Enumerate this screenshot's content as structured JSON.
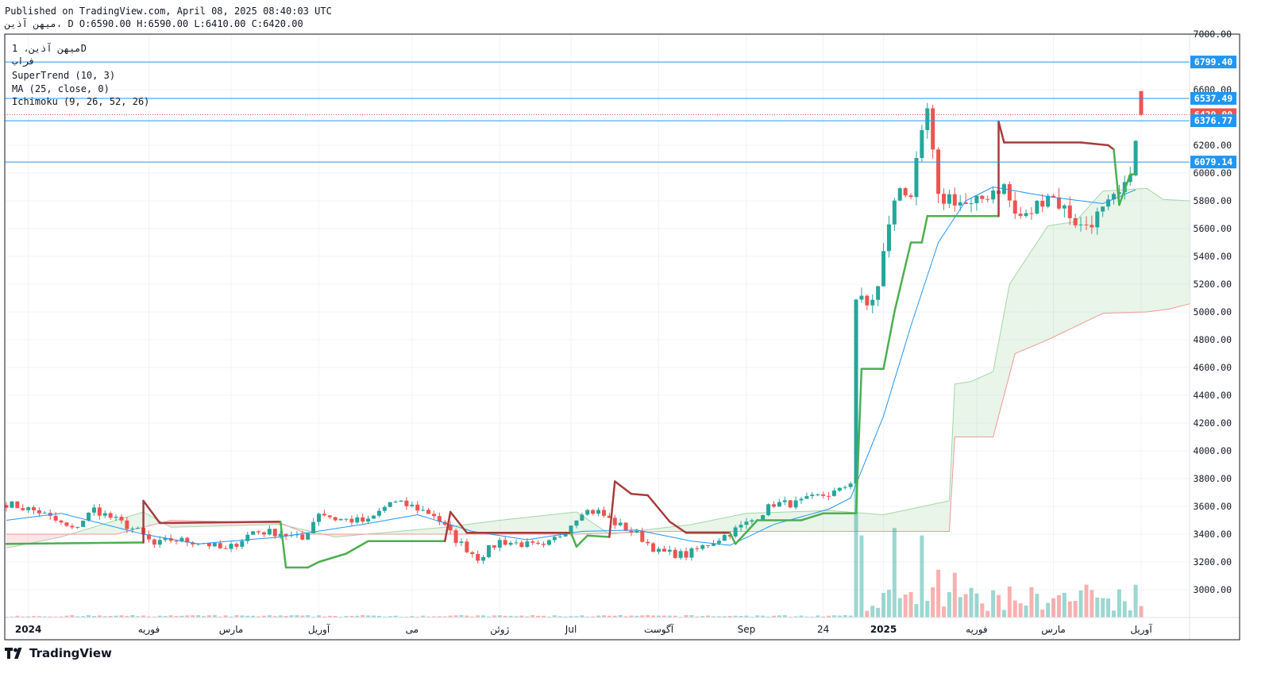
{
  "header": {
    "published": "Published on TradingView.com, April 08, 2025 08:40:03 UTC",
    "ohlc_line": "میهن آذین، D O:6590.00 H:6590.00 L:6410.00 C:6420.00"
  },
  "legend": {
    "symbol": "میهن آذین، 1D",
    "exchange": "فراب",
    "indicators": [
      "SuperTrend (10, 3)",
      "MA (25, close, 0)",
      "Ichimoku (9, 26, 52, 26)"
    ]
  },
  "brand": {
    "name": "TradingView"
  },
  "colors": {
    "up": "#26a69a",
    "down": "#ef5350",
    "supertrend_up": "#4caf50",
    "supertrend_down": "#a63d3d",
    "ma": "#2196f3",
    "hline": "#2196f3",
    "price": "#ef5350"
  },
  "chart_data": {
    "type": "candlestick",
    "ylim": [
      2800,
      7000
    ],
    "y_ticks": [
      3000,
      3200,
      3400,
      3600,
      3800,
      4000,
      4200,
      4400,
      4600,
      4800,
      5000,
      5200,
      5400,
      5600,
      5800,
      6000,
      6200,
      6400,
      6600,
      7000
    ],
    "x_labels": [
      "2024",
      "فوریه",
      "مارس",
      "آوریل",
      "می",
      "ژوئن",
      "Jul",
      "آگوست",
      "Sep",
      "24",
      "2025",
      "فوریه",
      "مارس",
      "آوریل"
    ],
    "x_label_index": [
      4,
      26,
      41,
      57,
      74,
      90,
      103,
      119,
      135,
      149,
      160,
      177,
      191,
      207
    ],
    "horizontal_levels": [
      6799.4,
      6537.49,
      6376.77,
      6079.14
    ],
    "last_price": 6420.0,
    "price_labels": [
      "6799.40",
      "6537.49",
      "6420.00",
      "6376.77",
      "6079.14"
    ],
    "last_candle": {
      "o": 6590,
      "h": 6590,
      "l": 6410,
      "c": 6420
    },
    "anchors": [
      [
        0,
        3620
      ],
      [
        6,
        3560
      ],
      [
        12,
        3430
      ],
      [
        16,
        3580
      ],
      [
        20,
        3500
      ],
      [
        24,
        3420
      ],
      [
        27,
        3320
      ],
      [
        30,
        3360
      ],
      [
        36,
        3340
      ],
      [
        40,
        3280
      ],
      [
        45,
        3420
      ],
      [
        50,
        3410
      ],
      [
        54,
        3360
      ],
      [
        57,
        3560
      ],
      [
        60,
        3510
      ],
      [
        66,
        3490
      ],
      [
        70,
        3630
      ],
      [
        74,
        3600
      ],
      [
        78,
        3540
      ],
      [
        82,
        3360
      ],
      [
        86,
        3230
      ],
      [
        90,
        3350
      ],
      [
        94,
        3330
      ],
      [
        98,
        3300
      ],
      [
        102,
        3430
      ],
      [
        105,
        3570
      ],
      [
        108,
        3560
      ],
      [
        111,
        3480
      ],
      [
        115,
        3400
      ],
      [
        119,
        3270
      ],
      [
        124,
        3250
      ],
      [
        128,
        3330
      ],
      [
        132,
        3410
      ],
      [
        136,
        3500
      ],
      [
        140,
        3620
      ],
      [
        144,
        3620
      ],
      [
        148,
        3670
      ],
      [
        152,
        3710
      ],
      [
        154,
        3780
      ],
      [
        155,
        5100
      ],
      [
        157,
        5040
      ],
      [
        159,
        5170
      ],
      [
        161,
        5650
      ],
      [
        163,
        5900
      ],
      [
        165,
        5850
      ],
      [
        167,
        6250
      ],
      [
        168,
        6450
      ],
      [
        170,
        5800
      ],
      [
        172,
        5830
      ],
      [
        176,
        5750
      ],
      [
        180,
        5880
      ],
      [
        182,
        5900
      ],
      [
        184,
        5700
      ],
      [
        186,
        5680
      ],
      [
        188,
        5770
      ],
      [
        190,
        5860
      ],
      [
        192,
        5780
      ],
      [
        194,
        5700
      ],
      [
        196,
        5610
      ],
      [
        198,
        5660
      ],
      [
        200,
        5720
      ],
      [
        202,
        5800
      ],
      [
        204,
        5880
      ],
      [
        206,
        6200
      ],
      [
        207,
        6590
      ]
    ],
    "supertrend": [
      [
        0,
        3330,
        "up"
      ],
      [
        25,
        3340,
        "up"
      ],
      [
        25,
        3640,
        "down"
      ],
      [
        28,
        3480,
        "down"
      ],
      [
        50,
        3490,
        "down"
      ],
      [
        51,
        3160,
        "up"
      ],
      [
        55,
        3160,
        "up"
      ],
      [
        57,
        3200,
        "up"
      ],
      [
        62,
        3260,
        "up"
      ],
      [
        66,
        3350,
        "up"
      ],
      [
        80,
        3350,
        "up"
      ],
      [
        81,
        3560,
        "down"
      ],
      [
        84,
        3410,
        "down"
      ],
      [
        103,
        3410,
        "down"
      ],
      [
        104,
        3310,
        "up"
      ],
      [
        106,
        3390,
        "up"
      ],
      [
        110,
        3380,
        "up"
      ],
      [
        111,
        3780,
        "down"
      ],
      [
        114,
        3690,
        "down"
      ],
      [
        117,
        3680,
        "down"
      ],
      [
        121,
        3490,
        "down"
      ],
      [
        124,
        3410,
        "down"
      ],
      [
        132,
        3410,
        "down"
      ],
      [
        133,
        3330,
        "up"
      ],
      [
        137,
        3500,
        "up"
      ],
      [
        145,
        3500,
        "up"
      ],
      [
        149,
        3550,
        "up"
      ],
      [
        155,
        3550,
        "up"
      ],
      [
        156,
        4590,
        "up"
      ],
      [
        160,
        4590,
        "up"
      ],
      [
        162,
        5000,
        "up"
      ],
      [
        165,
        5500,
        "up"
      ],
      [
        167,
        5500,
        "up"
      ],
      [
        168,
        5690,
        "up"
      ],
      [
        181,
        5690,
        "up"
      ],
      [
        181,
        6370,
        "down"
      ],
      [
        182,
        6220,
        "down"
      ],
      [
        196,
        6220,
        "down"
      ],
      [
        201,
        6200,
        "down"
      ],
      [
        202,
        6170,
        "down"
      ],
      [
        203,
        5770,
        "up"
      ],
      [
        205,
        5990,
        "up"
      ],
      [
        206,
        5990,
        "up"
      ]
    ],
    "ma": [
      [
        0,
        3500
      ],
      [
        10,
        3550
      ],
      [
        25,
        3400
      ],
      [
        35,
        3330
      ],
      [
        50,
        3380
      ],
      [
        65,
        3470
      ],
      [
        75,
        3540
      ],
      [
        85,
        3420
      ],
      [
        95,
        3360
      ],
      [
        105,
        3420
      ],
      [
        115,
        3430
      ],
      [
        125,
        3350
      ],
      [
        132,
        3320
      ],
      [
        140,
        3470
      ],
      [
        150,
        3580
      ],
      [
        154,
        3660
      ],
      [
        160,
        4250
      ],
      [
        165,
        4900
      ],
      [
        170,
        5500
      ],
      [
        175,
        5800
      ],
      [
        180,
        5900
      ],
      [
        190,
        5830
      ],
      [
        200,
        5780
      ],
      [
        206,
        5880
      ]
    ],
    "ichimoku": {
      "span_a": [
        [
          0,
          3300
        ],
        [
          10,
          3380
        ],
        [
          25,
          3560
        ],
        [
          30,
          3450
        ],
        [
          50,
          3470
        ],
        [
          60,
          3380
        ],
        [
          80,
          3450
        ],
        [
          90,
          3500
        ],
        [
          104,
          3560
        ],
        [
          110,
          3400
        ],
        [
          125,
          3470
        ],
        [
          135,
          3550
        ],
        [
          150,
          3570
        ],
        [
          160,
          3540
        ],
        [
          172,
          3640
        ],
        [
          173,
          4480
        ],
        [
          176,
          4500
        ],
        [
          180,
          4570
        ],
        [
          183,
          5200
        ],
        [
          190,
          5620
        ],
        [
          195,
          5650
        ],
        [
          200,
          5870
        ],
        [
          208,
          5890
        ],
        [
          211,
          5810
        ],
        [
          216,
          5800
        ]
      ],
      "span_b": [
        [
          0,
          3400
        ],
        [
          20,
          3400
        ],
        [
          30,
          3500
        ],
        [
          50,
          3480
        ],
        [
          55,
          3400
        ],
        [
          90,
          3400
        ],
        [
          104,
          3400
        ],
        [
          120,
          3420
        ],
        [
          160,
          3420
        ],
        [
          172,
          3420
        ],
        [
          173,
          4100
        ],
        [
          180,
          4100
        ],
        [
          184,
          4700
        ],
        [
          190,
          4800
        ],
        [
          200,
          4990
        ],
        [
          208,
          5000
        ],
        [
          212,
          5020
        ],
        [
          216,
          5060
        ]
      ]
    },
    "volume_spikes": [
      [
        155,
        1.0
      ],
      [
        156,
        0.55
      ],
      [
        162,
        0.6
      ],
      [
        167,
        0.55
      ],
      [
        170,
        0.32
      ],
      [
        173,
        0.3
      ],
      [
        197,
        0.22
      ],
      [
        206,
        0.22
      ]
    ]
  }
}
